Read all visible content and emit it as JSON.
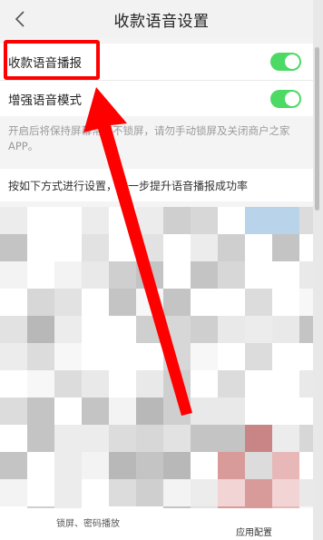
{
  "header": {
    "title": "收款语音设置"
  },
  "settings": {
    "rows": [
      {
        "label": "收款语音播报",
        "enabled": true
      },
      {
        "label": "增强语音模式",
        "enabled": true
      }
    ],
    "hint": "开启后将保持屏幕常亮不锁屏，请勿手动锁屏及关闭商户之家APP。"
  },
  "instruction": "按如下方式进行设置，进一步提升语音播报成功率",
  "bottom": {
    "left_text": "锁屏、密码播放",
    "right_text": "应用配置"
  },
  "colors": {
    "toggle_on": "#4cd964",
    "annotation_red": "#ff0000"
  }
}
